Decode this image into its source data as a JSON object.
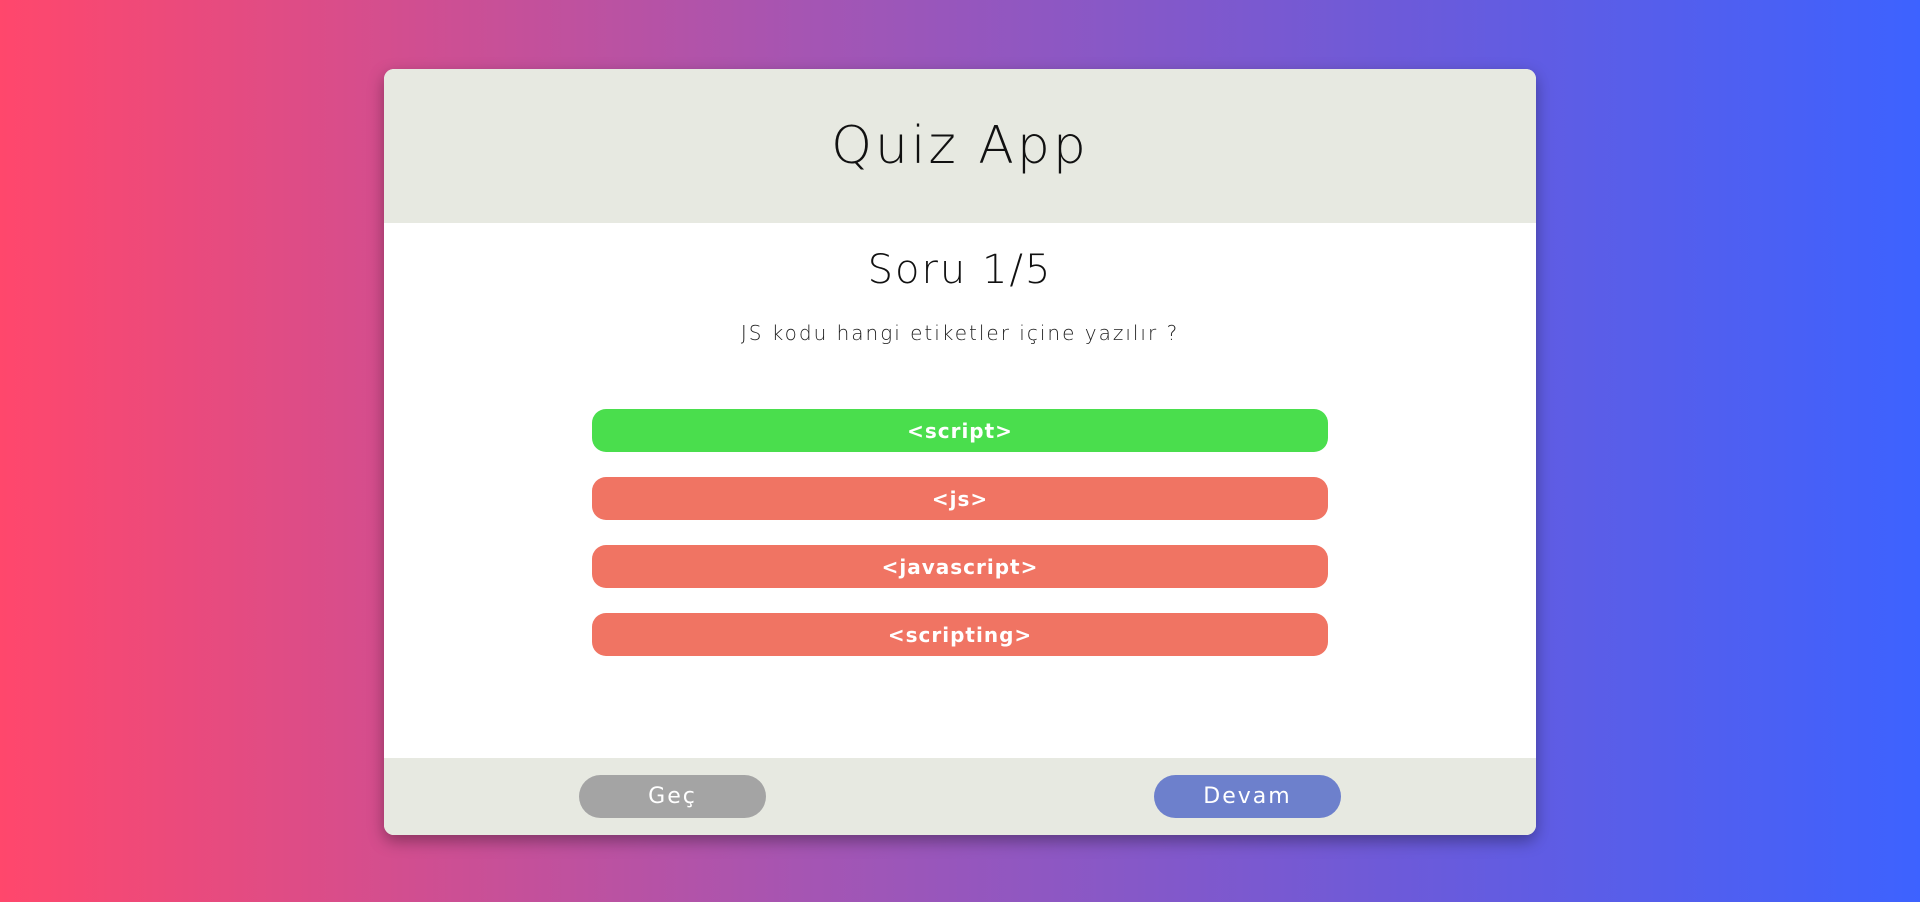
{
  "header": {
    "title": "Quiz App"
  },
  "question": {
    "counter": "Soru 1/5",
    "text": "JS kodu hangi etiketler içine yazılır ?"
  },
  "answers": [
    {
      "label": "<script>",
      "state": "correct"
    },
    {
      "label": "<js>",
      "state": "wrong"
    },
    {
      "label": "<javascript>",
      "state": "wrong"
    },
    {
      "label": "<scripting>",
      "state": "wrong"
    }
  ],
  "footer": {
    "skip_label": "Geç",
    "next_label": "Devam"
  },
  "colors": {
    "correct": "#4ade4d",
    "wrong": "#f07463",
    "skip_button": "#a4a4a4",
    "next_button": "#6d80cc",
    "header_bg": "#e7e9e1"
  }
}
